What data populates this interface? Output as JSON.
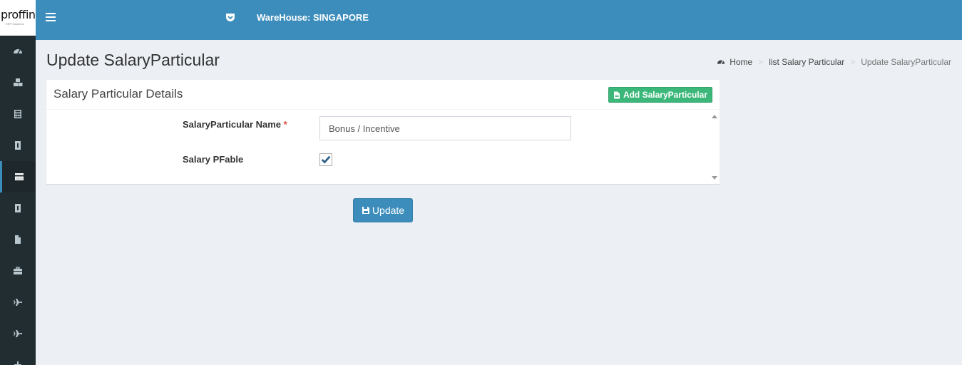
{
  "brand": {
    "logo_text": "proffin",
    "logo_subtext": "ERP Solutions"
  },
  "header": {
    "warehouse_label": "WareHouse: SINGAPORE"
  },
  "sidebar": {
    "items": [
      {
        "icon": "dashboard-icon"
      },
      {
        "icon": "cubes-icon"
      },
      {
        "icon": "calculator-icon"
      },
      {
        "icon": "id-badge-icon"
      },
      {
        "icon": "credit-card-icon",
        "active": true
      },
      {
        "icon": "id-badge-icon"
      },
      {
        "icon": "file-icon"
      },
      {
        "icon": "briefcase-icon"
      },
      {
        "icon": "plane-icon"
      },
      {
        "icon": "plane-icon"
      },
      {
        "icon": "plus-icon"
      }
    ]
  },
  "page": {
    "title": "Update SalaryParticular"
  },
  "breadcrumb": {
    "home": "Home",
    "list": "list Salary Particular",
    "current": "Update SalaryParticular"
  },
  "box": {
    "title": "Salary Particular Details",
    "add_button": "Add SalaryParticular"
  },
  "form": {
    "name_label": "SalaryParticular Name",
    "required_marker": "*",
    "name_value": "Bonus / Incentive",
    "pfable_label": "Salary PFable",
    "pfable_checked": true
  },
  "actions": {
    "update_label": "Update"
  },
  "colors": {
    "primary": "#3c8dbc",
    "success": "#3cb77a",
    "sidebar": "#222d32",
    "background": "#ecf0f5"
  }
}
